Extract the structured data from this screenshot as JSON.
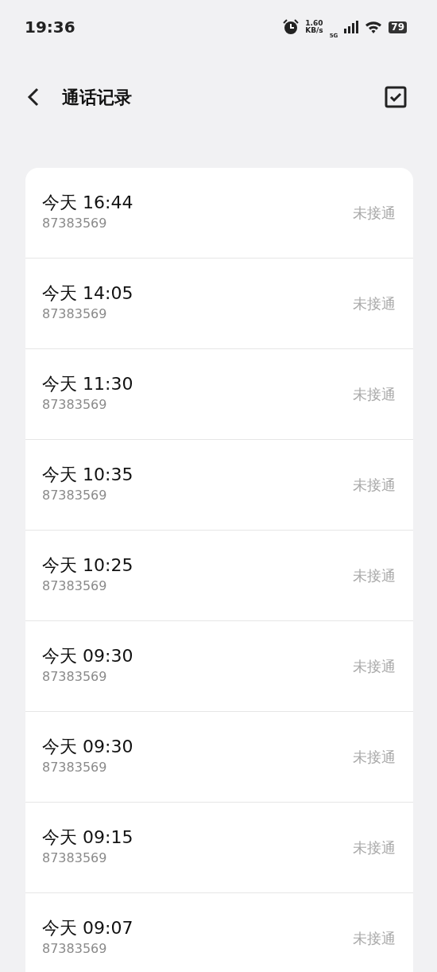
{
  "status_bar": {
    "time": "19:36",
    "speed_value": "1.60",
    "speed_unit": "KB/s",
    "network": "5G",
    "battery": "79"
  },
  "header": {
    "title": "通话记录"
  },
  "calls": [
    {
      "time": "今天 16:44",
      "number": "87383569",
      "status": "未接通"
    },
    {
      "time": "今天 14:05",
      "number": "87383569",
      "status": "未接通"
    },
    {
      "time": "今天 11:30",
      "number": "87383569",
      "status": "未接通"
    },
    {
      "time": "今天 10:35",
      "number": "87383569",
      "status": "未接通"
    },
    {
      "time": "今天 10:25",
      "number": "87383569",
      "status": "未接通"
    },
    {
      "time": "今天 09:30",
      "number": "87383569",
      "status": "未接通"
    },
    {
      "time": "今天 09:30",
      "number": "87383569",
      "status": "未接通"
    },
    {
      "time": "今天 09:15",
      "number": "87383569",
      "status": "未接通"
    },
    {
      "time": "今天 09:07",
      "number": "87383569",
      "status": "未接通"
    }
  ]
}
